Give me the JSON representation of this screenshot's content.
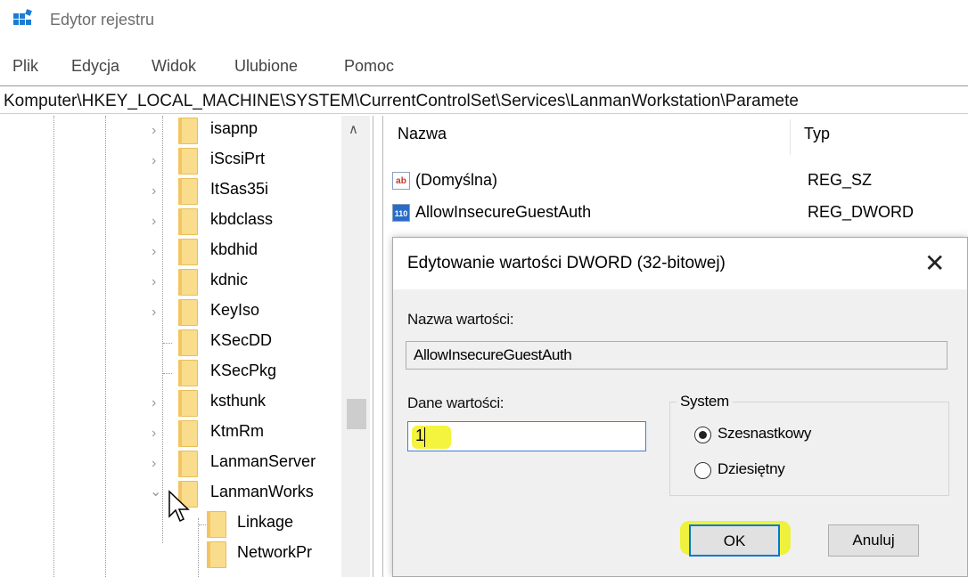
{
  "window": {
    "title": "Edytor rejestru"
  },
  "menu": [
    "Plik",
    "Edycja",
    "Widok",
    "Ulubione",
    "Pomoc"
  ],
  "address": "Komputer\\HKEY_LOCAL_MACHINE\\SYSTEM\\CurrentControlSet\\Services\\LanmanWorkstation\\Paramete",
  "tree": [
    {
      "label": "isapnp",
      "expander": "collapsed"
    },
    {
      "label": "iScsiPrt",
      "expander": "collapsed"
    },
    {
      "label": "ItSas35i",
      "expander": "collapsed"
    },
    {
      "label": "kbdclass",
      "expander": "collapsed"
    },
    {
      "label": "kbdhid",
      "expander": "collapsed"
    },
    {
      "label": "kdnic",
      "expander": "collapsed"
    },
    {
      "label": "KeyIso",
      "expander": "collapsed"
    },
    {
      "label": "KSecDD",
      "expander": "none"
    },
    {
      "label": "KSecPkg",
      "expander": "none"
    },
    {
      "label": "ksthunk",
      "expander": "collapsed"
    },
    {
      "label": "KtmRm",
      "expander": "collapsed"
    },
    {
      "label": "LanmanServer",
      "expander": "collapsed"
    },
    {
      "label": "LanmanWorks",
      "expander": "expanded"
    }
  ],
  "tree_children": [
    {
      "label": "Linkage"
    },
    {
      "label": "NetworkPr"
    }
  ],
  "list": {
    "columns": {
      "name": "Nazwa",
      "type": "Typ"
    },
    "rows": [
      {
        "icon": "string-value-icon",
        "icon_text": "ab",
        "name": "(Domyślna)",
        "type": "REG_SZ"
      },
      {
        "icon": "binary-value-icon",
        "icon_text": "110",
        "name": "AllowInsecureGuestAuth",
        "type": "REG_DWORD"
      }
    ]
  },
  "dialog": {
    "title": "Edytowanie wartości DWORD (32-bitowej)",
    "close": "✕",
    "name_label": "Nazwa wartości:",
    "name_value": "AllowInsecureGuestAuth",
    "data_label": "Dane wartości:",
    "data_value": "1",
    "base_group": "System",
    "base_options": [
      {
        "label": "Szesnastkowy",
        "checked": true
      },
      {
        "label": "Dziesiętny",
        "checked": false
      }
    ],
    "ok": "OK",
    "cancel": "Anuluj"
  },
  "colors": {
    "highlight": "#f3f32a",
    "folder": "#f9dc8c",
    "focus": "#0078d7"
  }
}
